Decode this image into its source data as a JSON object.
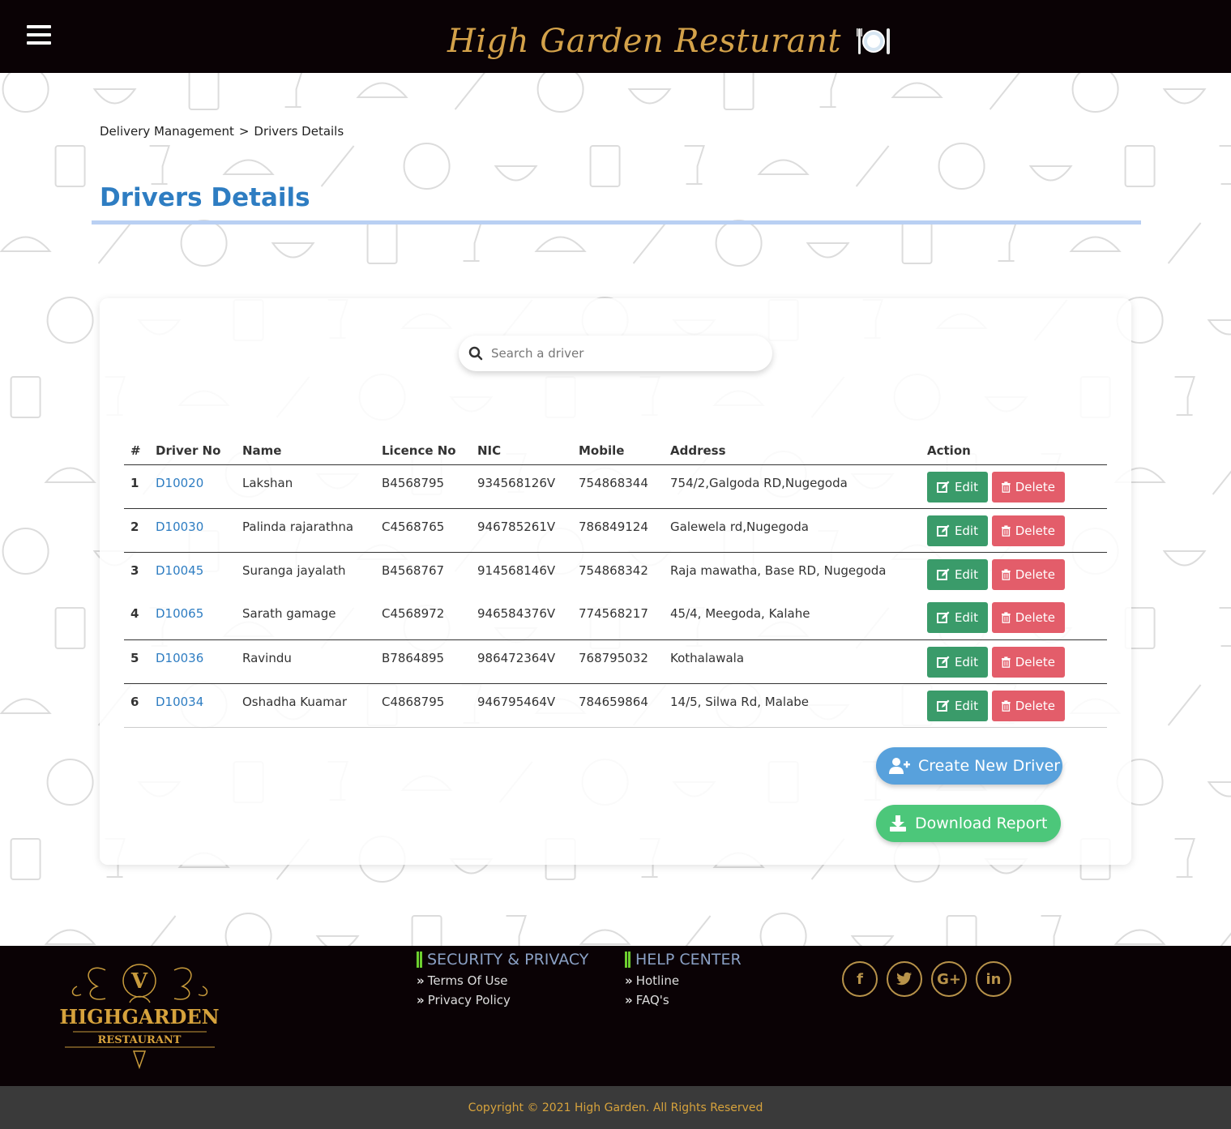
{
  "header": {
    "title": "High Garden Resturant",
    "menu_icon": "hamburger-menu-icon",
    "logo_icon": "plate-cutlery-icon",
    "title_color": "#d4a24a"
  },
  "breadcrumb": {
    "parent": "Delivery Management",
    "separator": ">",
    "current": "Drivers Details"
  },
  "page": {
    "title": "Drivers Details",
    "title_color": "#2e7dc2"
  },
  "search": {
    "placeholder": "Search a driver",
    "value": "",
    "icon": "search-icon"
  },
  "table": {
    "headers": [
      "#",
      "Driver No",
      "Name",
      "Licence No",
      "NIC",
      "Mobile",
      "Address",
      "Action"
    ],
    "rows": [
      {
        "index": "1",
        "driver_no": "D10020",
        "name": "Lakshan",
        "licence_no": "B4568795",
        "nic": "934568126V",
        "mobile": "754868344",
        "address": "754/2,Galgoda RD,Nugegoda"
      },
      {
        "index": "2",
        "driver_no": "D10030",
        "name": "Palinda rajarathna",
        "licence_no": "C4568765",
        "nic": "946785261V",
        "mobile": "786849124",
        "address": "Galewela rd,Nugegoda"
      },
      {
        "index": "3",
        "driver_no": "D10045",
        "name": "Suranga jayalath",
        "licence_no": "B4568767",
        "nic": "914568146V",
        "mobile": "754868342",
        "address": "Raja mawatha, Base RD, Nugegoda"
      },
      {
        "index": "4",
        "driver_no": "D10065",
        "name": "Sarath gamage",
        "licence_no": "C4568972",
        "nic": "946584376V",
        "mobile": "774568217",
        "address": "45/4, Meegoda, Kalahe"
      },
      {
        "index": "5",
        "driver_no": "D10036",
        "name": "Ravindu",
        "licence_no": "B7864895",
        "nic": "986472364V",
        "mobile": "768795032",
        "address": "Kothalawala"
      },
      {
        "index": "6",
        "driver_no": "D10034",
        "name": "Oshadha Kuamar",
        "licence_no": "C4868795",
        "nic": "946795464V",
        "mobile": "784659864",
        "address": "14/5, Silwa Rd, Malabe"
      }
    ],
    "edit_label": "Edit",
    "delete_label": "Delete",
    "edit_color": "#3a9b6a",
    "delete_color": "#e35d6a"
  },
  "buttons": {
    "create": "Create New Driver",
    "create_icon": "user-plus-icon",
    "download": "Download Report",
    "download_icon": "download-icon"
  },
  "footer": {
    "logo_line1": "HIGHGARDEN",
    "logo_line2": "RESTAURANT",
    "logo_monogram": "V",
    "security_heading": "SECURITY & PRIVACY",
    "security_links": [
      "Terms Of Use",
      "Privacy Policy"
    ],
    "help_heading": "HELP CENTER",
    "help_links": [
      "Hotline",
      "FAQ's"
    ],
    "social": [
      {
        "icon": "facebook-icon",
        "glyph": "f"
      },
      {
        "icon": "twitter-icon",
        "glyph": "t"
      },
      {
        "icon": "google-plus-icon",
        "glyph": "G+"
      },
      {
        "icon": "linkedin-icon",
        "glyph": "in"
      }
    ],
    "copyright": "Copyright © 2021 High Garden. All Rights Reserved"
  }
}
